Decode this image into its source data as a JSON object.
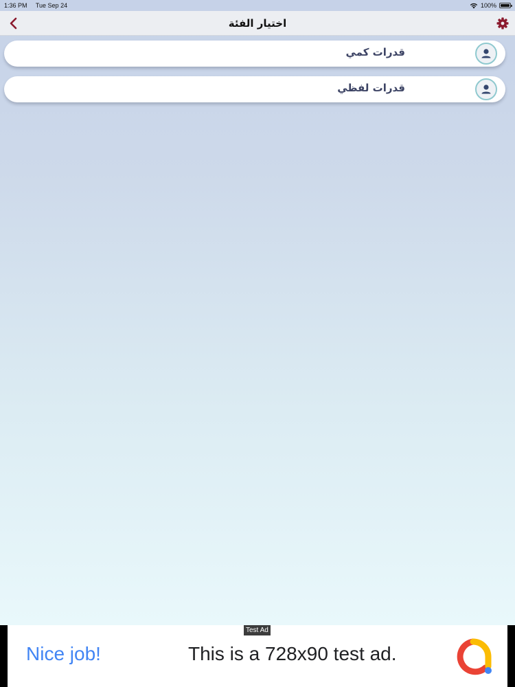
{
  "status_bar": {
    "time": "1:36 PM",
    "date": "Tue Sep 24",
    "battery": "100%",
    "wifi_icon": "wifi-icon",
    "battery_icon": "battery-icon"
  },
  "nav": {
    "title": "اختيار الفئة",
    "back_icon": "chevron-left-icon",
    "settings_icon": "gear-icon",
    "accent_color": "#8b1a2e"
  },
  "categories": [
    {
      "label": "قدرات كمي",
      "icon": "user-icon"
    },
    {
      "label": "قدرات لفظي",
      "icon": "user-icon"
    }
  ],
  "ad": {
    "tag": "Test Ad",
    "headline": "Nice job!",
    "body": "This is a 728x90 test ad.",
    "logo_icon": "admob-logo-icon",
    "headline_color": "#4285f4"
  }
}
